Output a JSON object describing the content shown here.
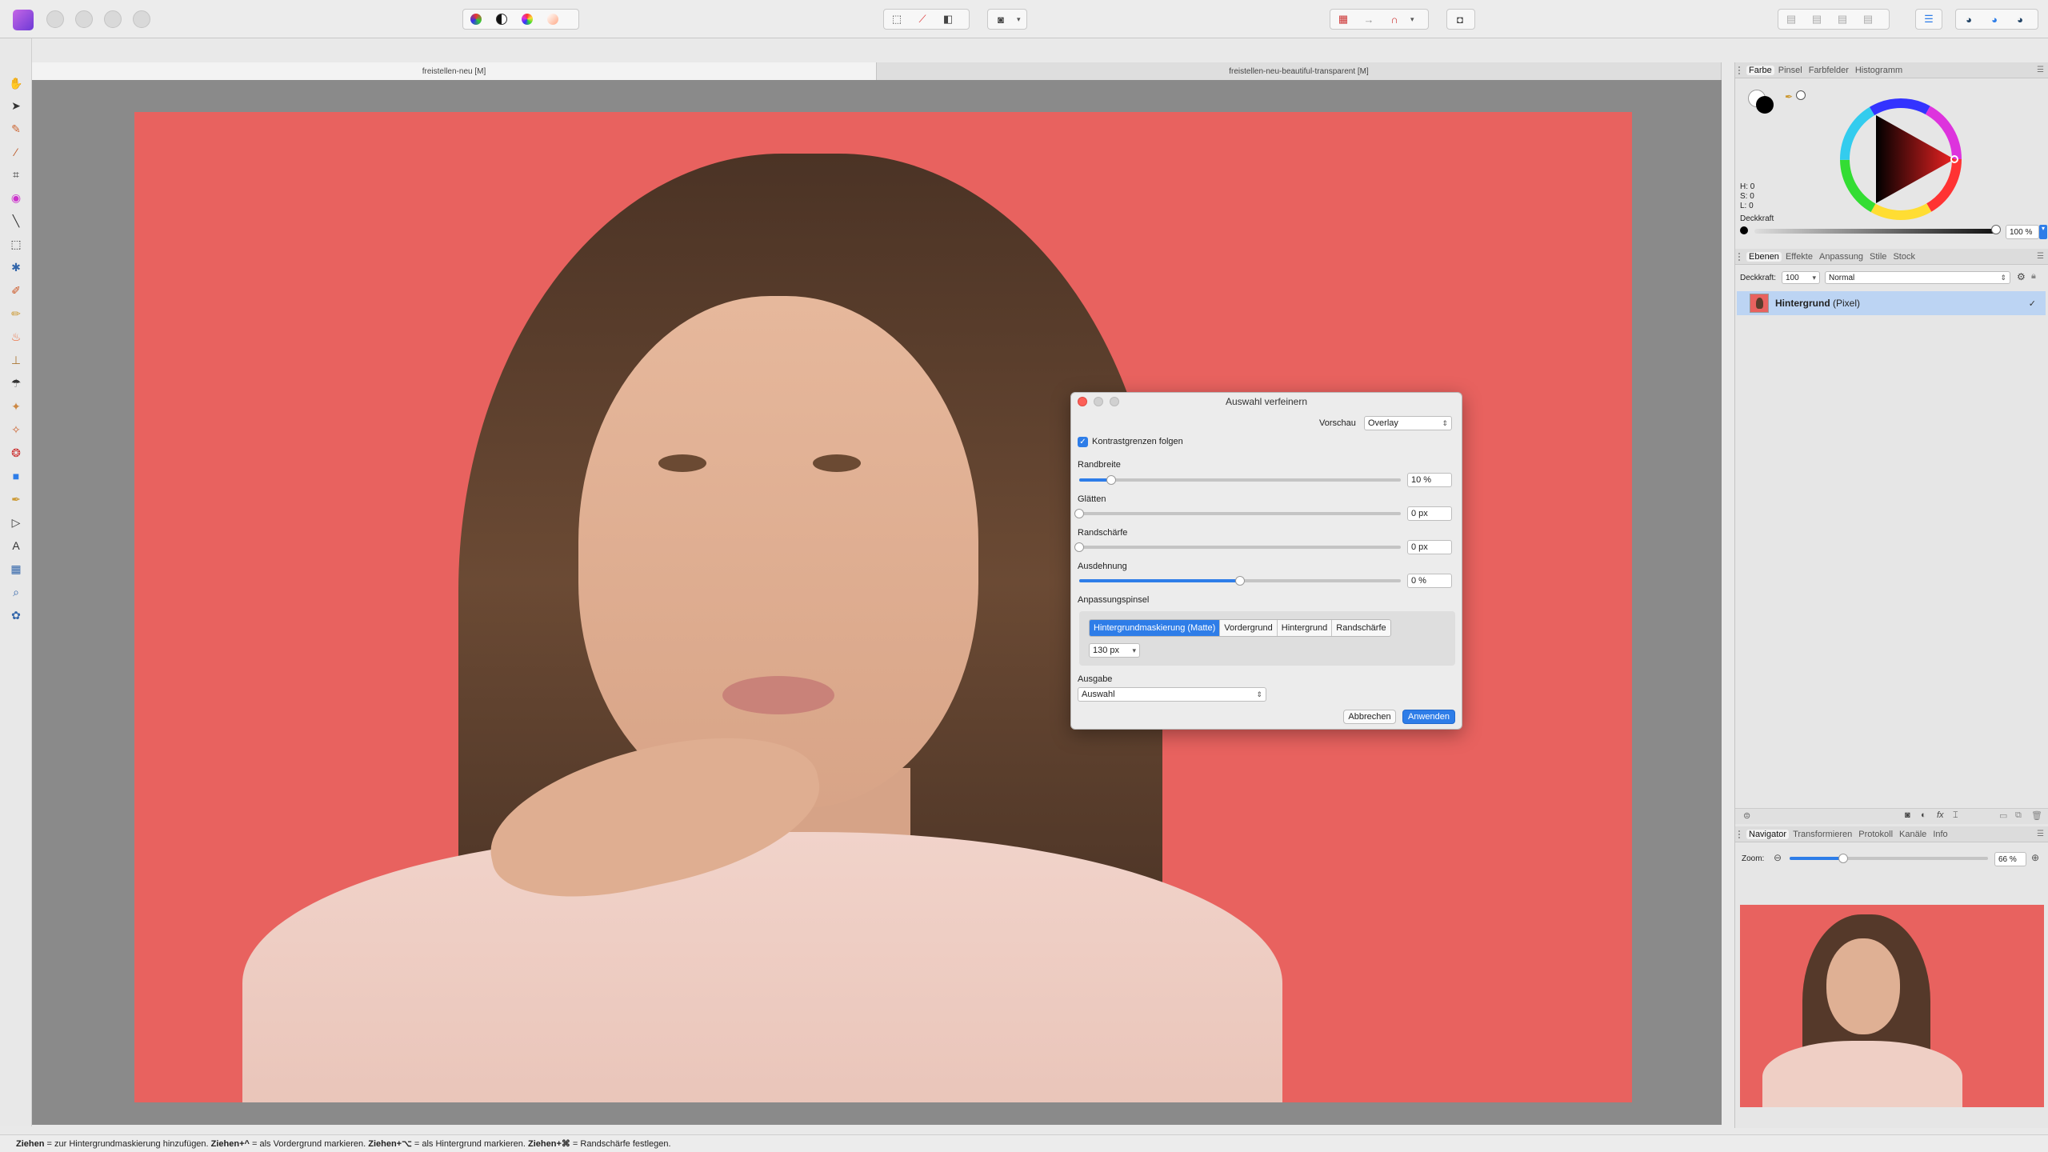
{
  "document_tabs": [
    {
      "label": "freistellen-neu [M]",
      "active": true
    },
    {
      "label": "freistellen-neu-beautiful-transparent [M]",
      "active": false
    }
  ],
  "dialog": {
    "title": "Auswahl verfeinern",
    "preview_label": "Vorschau",
    "preview_value": "Overlay",
    "contrast_checkbox_label": "Kontrastgrenzen folgen",
    "contrast_checked": true,
    "sliders": [
      {
        "label": "Randbreite",
        "value_text": "10 %",
        "fraction": 0.1
      },
      {
        "label": "Glätten",
        "value_text": "0 px",
        "fraction": 0.0
      },
      {
        "label": "Randschärfe",
        "value_text": "0 px",
        "fraction": 0.0
      },
      {
        "label": "Ausdehnung",
        "value_text": "0 %",
        "fraction": 0.5
      }
    ],
    "brush_label": "Anpassungspinsel",
    "brush_modes": [
      "Hintergrundmaskierung (Matte)",
      "Vordergrund",
      "Hintergrund",
      "Randschärfe"
    ],
    "brush_active_index": 0,
    "brush_size": "130 px",
    "output_label": "Ausgabe",
    "output_value": "Auswahl",
    "cancel_label": "Abbrechen",
    "apply_label": "Anwenden"
  },
  "color_panel": {
    "tabs": [
      "Farbe",
      "Pinsel",
      "Farbfelder",
      "Histogramm"
    ],
    "active_tab": 0,
    "hsl": {
      "h": "H: 0",
      "s": "S: 0",
      "l": "L: 0"
    },
    "opacity_label": "Deckkraft",
    "opacity_value": "100 %",
    "accent_color": "#2e7de8"
  },
  "layers_panel": {
    "tabs": [
      "Ebenen",
      "Effekte",
      "Anpassung",
      "Stile",
      "Stock"
    ],
    "active_tab": 0,
    "opacity_label": "Deckkraft:",
    "opacity_value": "100",
    "blend_mode": "Normal",
    "layer": {
      "name": "Hintergrund",
      "type": "(Pixel)",
      "visible": true
    }
  },
  "navigator_panel": {
    "tabs": [
      "Navigator",
      "Transformieren",
      "Protokoll",
      "Kanäle",
      "Info"
    ],
    "active_tab": 0,
    "zoom_label": "Zoom:",
    "zoom_value": "66 %",
    "zoom_fraction": 0.27
  },
  "status": {
    "parts": [
      {
        "bold": "Ziehen",
        "text": " = zur Hintergrundmaskierung hinzufügen. "
      },
      {
        "bold": "Ziehen+^",
        "text": " = als Vordergrund markieren. "
      },
      {
        "bold": "Ziehen+⌥",
        "text": " = als Hintergrund markieren. "
      },
      {
        "bold": "Ziehen+⌘",
        "text": " = Randschärfe festlegen."
      }
    ]
  },
  "photo_background_color": "#e8625f",
  "icons": {
    "tools": [
      "hand-icon",
      "move-icon",
      "pen-icon",
      "brush-icon",
      "crop-icon",
      "color-picker-icon",
      "straighten-icon",
      "marquee-icon",
      "flood-select-icon",
      "paint-brush-icon",
      "pencil-icon",
      "fire-icon",
      "clone-icon",
      "smudge-icon",
      "dodge-icon",
      "burn-icon",
      "sponge-icon",
      "rectangle-icon",
      "eyedropper-icon",
      "node-icon",
      "text-icon",
      "mesh-icon",
      "zoom-icon",
      "pattern-icon"
    ]
  }
}
